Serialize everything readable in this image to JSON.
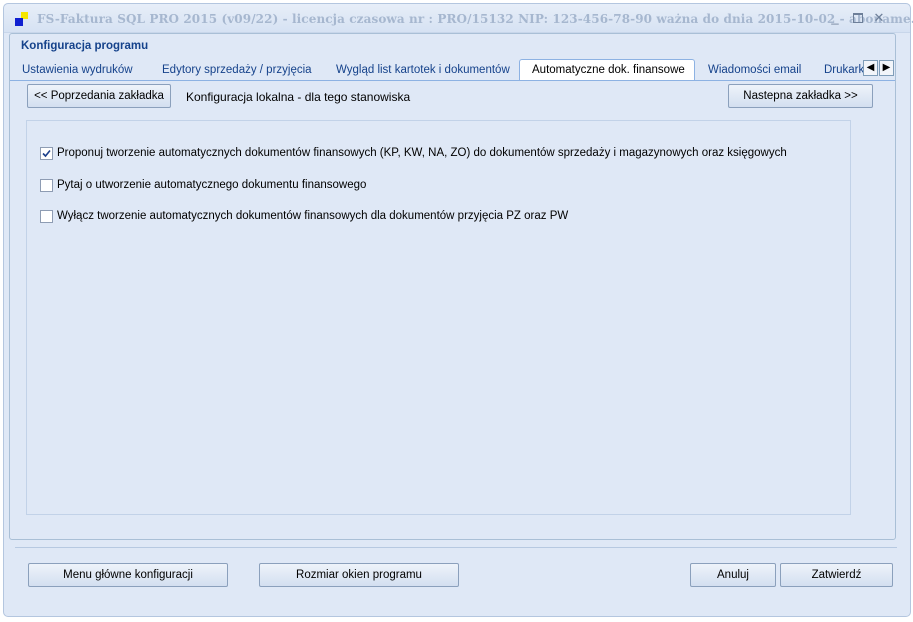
{
  "window": {
    "title": "FS-Faktura SQL PRO 2015 (v09/22)   -   licencja czasowa nr : PRO/15132     NIP: 123-456-78-90   ważna do dnia 2015-10-02   -   aboname...",
    "minimize_icon": "minimize-icon",
    "maximize_icon": "maximize-icon",
    "close_icon": "close-icon"
  },
  "header": {
    "title": "Konfiguracja programu"
  },
  "tabs": [
    {
      "label": "Ustawienia wydruków"
    },
    {
      "label": "Edytory sprzedaży / przyjęcia"
    },
    {
      "label": "Wygląd list kartotek i dokumentów"
    },
    {
      "label": "Automatyczne dok. finansowe",
      "active": true
    },
    {
      "label": "Wiadomości email"
    },
    {
      "label": "Drukarki"
    }
  ],
  "tab_scroll": {
    "left_icon": "arrow-left-icon",
    "right_icon": "arrow-right-icon"
  },
  "nav": {
    "prev_label": "<< Poprzedania zakładka",
    "caption": "Konfiguracja lokalna - dla tego stanowiska",
    "next_label": "Nastepna zakładka >>"
  },
  "options": [
    {
      "label": "Proponuj tworzenie automatycznych dokumentów finansowych (KP, KW, NA, ZO) do dokumentów sprzedaży i magazynowych  oraz księgowych",
      "checked": true
    },
    {
      "label": "Pytaj o utworzenie automatycznego dokumentu finansowego",
      "checked": false
    },
    {
      "label": "Wyłącz tworzenie automatycznych dokumentów finansowych dla dokumentów przyjęcia PZ oraz PW",
      "checked": false
    }
  ],
  "footer": {
    "menu_label": "Menu główne konfiguracji",
    "resize_label": "Rozmiar okien programu",
    "cancel_label": "Anuluj",
    "confirm_label": "Zatwierdź"
  }
}
